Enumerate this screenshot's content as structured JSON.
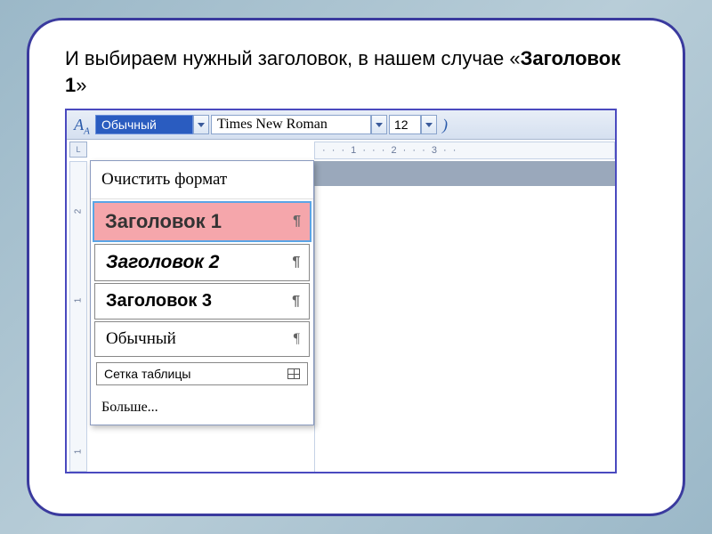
{
  "instruction": {
    "prefix": "    И выбираем нужный заголовок, в нашем случае «",
    "bold": "Заголовок 1",
    "suffix": "»"
  },
  "toolbar": {
    "aa": "A",
    "style_value": "Обычный",
    "font_value": "Times New Roman",
    "size_value": "12"
  },
  "ruler": {
    "horizontal": "·  ·  ·  1  ·  ·  ·  2  ·  ·  ·  3  ·  ·",
    "v1": "2",
    "v2": "1",
    "v3": "1"
  },
  "dropdown": {
    "clear": "Очистить формат",
    "h1": "Заголовок 1",
    "h2": "Заголовок 2",
    "h3": "Заголовок 3",
    "normal": "Обычный",
    "grid": "Сетка таблицы",
    "more": "Больше..."
  }
}
